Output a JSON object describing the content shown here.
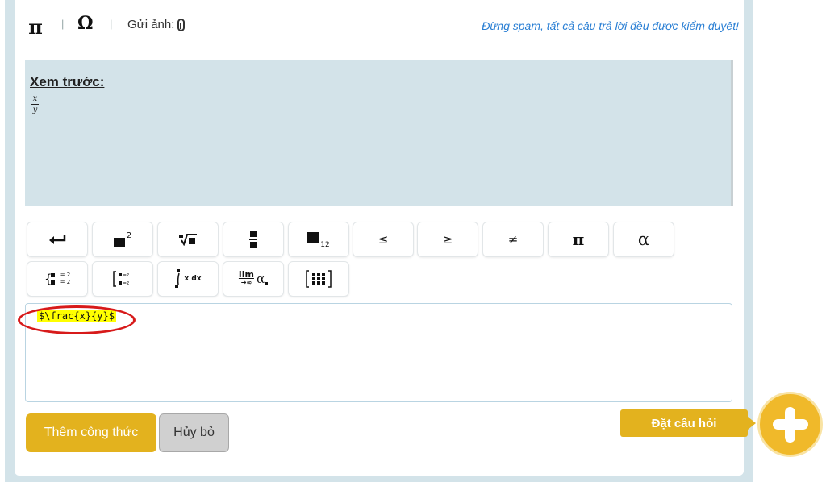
{
  "toolbar": {
    "pi_symbol": "π",
    "omega_symbol": "Ω",
    "separator": "|",
    "upload_label": "Gửi ảnh:",
    "notice": "Đừng spam, tất cả câu trả lời đều được kiểm duyệt!"
  },
  "preview": {
    "label": "Xem trước:",
    "numerator": "x",
    "denominator": "y"
  },
  "math_buttons": {
    "row1": [
      {
        "name": "newline",
        "glyph": "↵"
      },
      {
        "name": "square",
        "glyph": "2"
      },
      {
        "name": "nth-root",
        "glyph": "√"
      },
      {
        "name": "fraction",
        "glyph": ""
      },
      {
        "name": "subscript",
        "glyph": "12"
      },
      {
        "name": "leq",
        "glyph": "≤"
      },
      {
        "name": "geq",
        "glyph": "≥"
      },
      {
        "name": "neq",
        "glyph": "≠"
      },
      {
        "name": "pi",
        "glyph": "π"
      },
      {
        "name": "alpha",
        "glyph": "α"
      }
    ],
    "row2": [
      {
        "name": "system",
        "glyph": "= 2"
      },
      {
        "name": "cases",
        "glyph": "=z"
      },
      {
        "name": "integral",
        "glyph": "x dx"
      },
      {
        "name": "limit",
        "glyph": "lim"
      },
      {
        "name": "matrix",
        "glyph": ""
      }
    ],
    "integral_label": "x dx",
    "limit_label": "lim",
    "limit_sub": "→∞",
    "limit_alpha": "α",
    "system_eq": "= 2"
  },
  "editor": {
    "value": "$\\frac{x}{y}$"
  },
  "actions": {
    "insert_formula": "Thêm công thức",
    "cancel": "Hủy bỏ",
    "ask_question": "Đặt câu hỏi"
  },
  "colors": {
    "accent": "#e3b21e",
    "panel_bg": "#d3e3e9",
    "notice": "#2a7fd4",
    "highlight": "#ffff00",
    "annotation_ring": "#d71a1a"
  }
}
